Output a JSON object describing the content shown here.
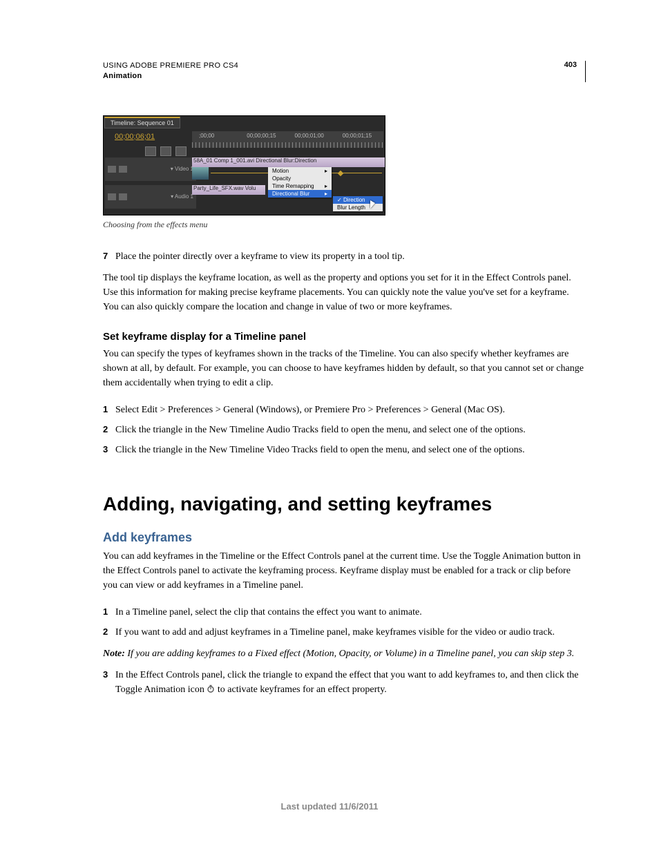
{
  "header": {
    "doc_title": "USING ADOBE PREMIERE PRO CS4",
    "section": "Animation",
    "page_number": "403"
  },
  "figure": {
    "tab_label": "Timeline: Sequence 01",
    "main_timecode": "00;00;06;01",
    "ruler_marks": [
      ";00;00",
      "00;00;00;15",
      "00;00;01;00",
      "00;00;01;15"
    ],
    "video_track_label": "Video 1",
    "audio_track_label": "Audio 1",
    "video_clip_label": "58A_01 Comp 1_001.avi Directional Blur:Direction",
    "audio_clip_label": "Party_Life_SFX.wav  Volu",
    "menu_items": [
      "Motion",
      "Opacity",
      "Time Remapping",
      "Directional Blur"
    ],
    "submenu_items": [
      "Direction",
      "Blur Length"
    ],
    "caption": "Choosing from the effects menu"
  },
  "steps_a": {
    "s7": "Place the pointer directly over a keyframe to view its property in a tool tip."
  },
  "para1": "The tool tip displays the keyframe location, as well as the property and options you set for it in the Effect Controls panel. Use this information for making precise keyframe placements. You can quickly note the value you've set for a keyframe. You can also quickly compare the location and change in value of two or more keyframes.",
  "heading_b": "Set keyframe display for a Timeline panel",
  "para_b": "You can specify the types of keyframes shown in the tracks of the Timeline. You can also specify whether keyframes are shown at all, by default. For example, you can choose to have keyframes hidden by default, so that you cannot set or change them accidentally when trying to edit a clip.",
  "steps_b": {
    "s1": "Select Edit > Preferences > General (Windows), or Premiere Pro > Preferences > General (Mac OS).",
    "s2": "Click the triangle in the New Timeline Audio Tracks field to open the menu, and select one of the options.",
    "s3": "Click the triangle in the New Timeline Video Tracks field to open the menu, and select one of the options."
  },
  "heading_main": "Adding, navigating, and setting keyframes",
  "heading_c": "Add keyframes",
  "para_c": "You can add keyframes in the Timeline or the Effect Controls panel at the current time. Use the Toggle Animation button in the Effect Controls panel to activate the keyframing process. Keyframe display must be enabled for a track or clip before you can view or add keyframes in a Timeline panel.",
  "steps_c": {
    "s1": "In a Timeline panel, select the clip that contains the effect you want to animate.",
    "s2": " If you want to add and adjust keyframes in a Timeline panel, make keyframes visible for the video or audio track."
  },
  "note": {
    "label": "Note: ",
    "body": "If you are adding keyframes to a Fixed effect (Motion, Opacity, or Volume) in a Timeline panel, you can skip step 3."
  },
  "steps_d": {
    "s3a": "In the Effect Controls panel, click the triangle to expand the effect that you want to add keyframes to, and then click the Toggle Animation icon ",
    "s3b": " to activate keyframes for an effect property."
  },
  "footer": "Last updated 11/6/2011"
}
